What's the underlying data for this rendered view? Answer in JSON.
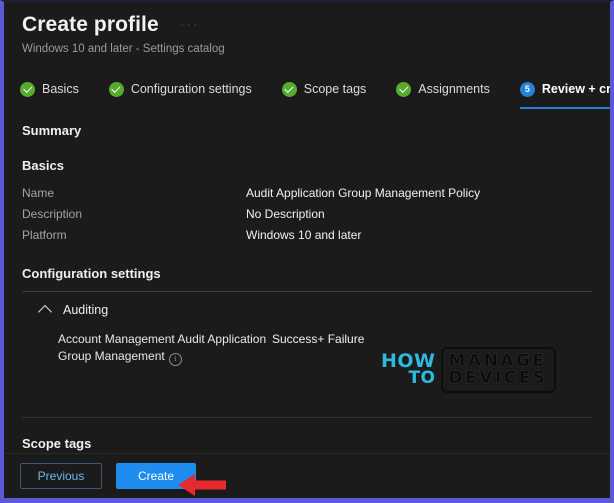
{
  "window": {
    "accent_border": "#5b59d6",
    "background": "#1b1b1b"
  },
  "header": {
    "title": "Create profile",
    "overflow_menu": "···",
    "subtitle": "Windows 10 and later - Settings catalog"
  },
  "steps": [
    {
      "label": "Basics",
      "state": "completed",
      "number": "1"
    },
    {
      "label": "Configuration settings",
      "state": "completed",
      "number": "2"
    },
    {
      "label": "Scope tags",
      "state": "completed",
      "number": "3"
    },
    {
      "label": "Assignments",
      "state": "completed",
      "number": "4"
    },
    {
      "label": "Review + create",
      "state": "current",
      "number": "5"
    }
  ],
  "main": {
    "summary_heading": "Summary",
    "basics": {
      "heading": "Basics",
      "rows": [
        {
          "key": "Name",
          "value": "Audit Application Group Management Policy"
        },
        {
          "key": "Description",
          "value": "No Description"
        },
        {
          "key": "Platform",
          "value": "Windows 10 and later"
        }
      ]
    },
    "configuration_settings": {
      "heading": "Configuration settings",
      "group": {
        "label": "Auditing",
        "expanded": true,
        "settings": [
          {
            "name": "Account Management Audit Application Group Management",
            "info": "ⓘ",
            "value": "Success+ Failure"
          }
        ]
      }
    },
    "scope_tags": {
      "heading": "Scope tags"
    }
  },
  "watermark": {
    "line1": "HOW",
    "line2": "TO",
    "line3": "MANAGE",
    "line4": "DEVICES",
    "accent": "#2ec8f0"
  },
  "footer": {
    "previous_label": "Previous",
    "create_label": "Create",
    "primary_color": "#1f8cf0",
    "annotation_arrow_color": "#e8292f"
  }
}
